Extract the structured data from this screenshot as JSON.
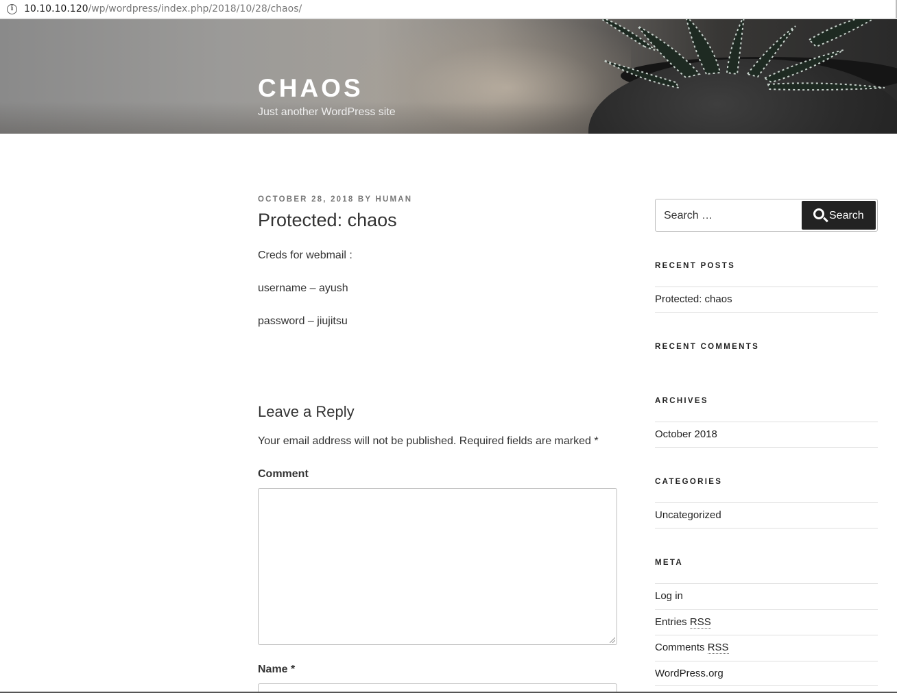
{
  "browser": {
    "url_host": "10.10.10.120",
    "url_path": "/wp/wordpress/index.php/2018/10/28/chaos/"
  },
  "site": {
    "title": "CHAOS",
    "description": "Just another WordPress site"
  },
  "post": {
    "date": "October 28, 2018",
    "by_label": "by",
    "author": "human",
    "title": "Protected: chaos",
    "paragraphs": [
      "Creds for webmail :",
      "username – ayush",
      "password – jiujitsu"
    ]
  },
  "reply": {
    "title": "Leave a Reply",
    "notes": "Your email address will not be published. Required fields are marked *",
    "comment_label": "Comment",
    "name_label": "Name *"
  },
  "sidebar": {
    "search": {
      "placeholder": "Search …",
      "button_label": "Search"
    },
    "recent_posts": {
      "title": "Recent Posts",
      "items": [
        "Protected: chaos"
      ]
    },
    "recent_comments": {
      "title": "Recent Comments"
    },
    "archives": {
      "title": "Archives",
      "items": [
        "October 2018"
      ]
    },
    "categories": {
      "title": "Categories",
      "items": [
        "Uncategorized"
      ]
    },
    "meta": {
      "title": "Meta",
      "login": "Log in",
      "entries_prefix": "Entries",
      "comments_prefix": "Comments",
      "rss": "RSS",
      "wordpress_org": "WordPress.org"
    }
  }
}
